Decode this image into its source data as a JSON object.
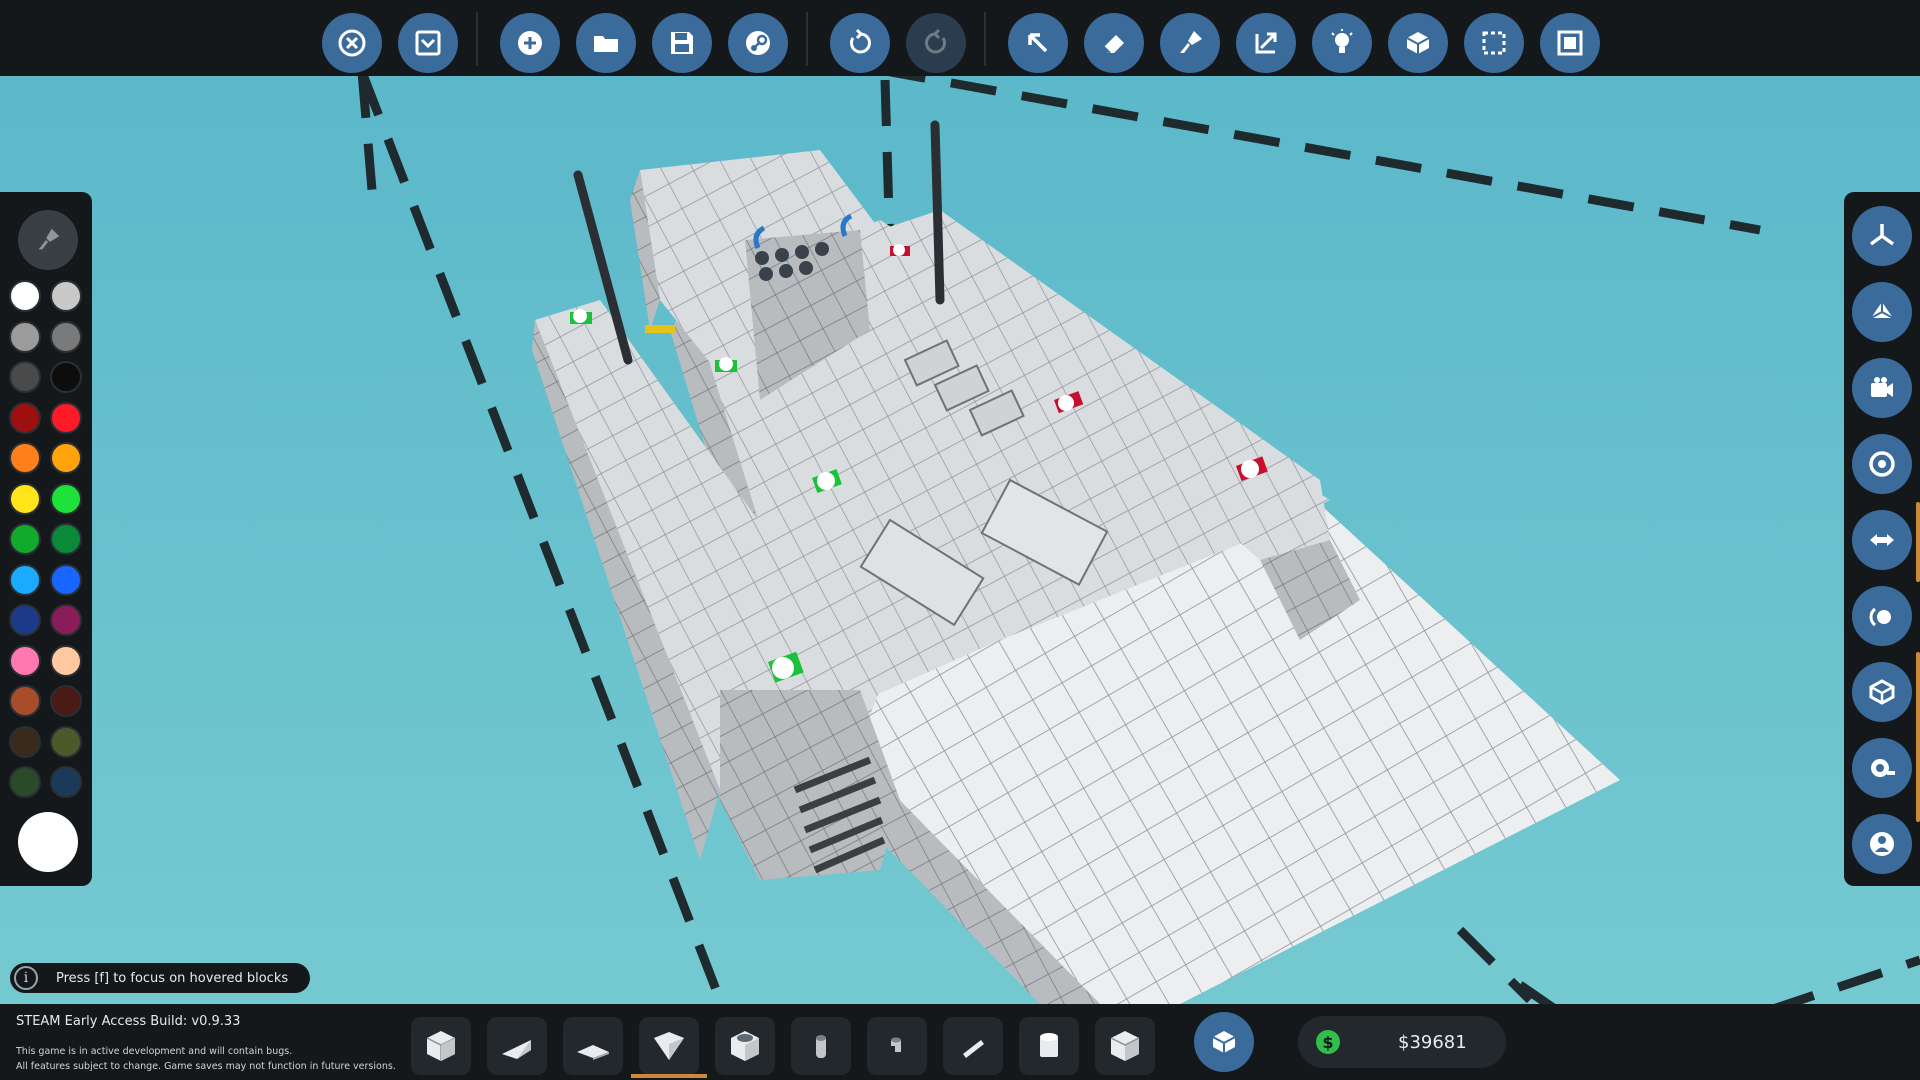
{
  "hint": {
    "text": "Press [f] to focus on hovered blocks",
    "icon": "info-icon"
  },
  "build": {
    "title": "STEAM Early Access Build: v0.9.33",
    "note1": "This game is in active development and will contain bugs.",
    "note2": "All features subject to change. Game saves may not function in future versions."
  },
  "money": {
    "value": "$39681",
    "icon": "dollar-icon",
    "color": "#2fbf4a"
  },
  "toolbar": {
    "icons": [
      "close-icon",
      "dropdown-icon",
      "add-icon",
      "folder-icon",
      "save-icon",
      "steam-icon",
      "undo-icon",
      "redo-icon",
      "select-arrow-icon",
      "eraser-icon",
      "paint-icon",
      "scale-icon",
      "light-icon",
      "blocks-icon",
      "selection-icon",
      "fullscreen-icon"
    ]
  },
  "right_panel": {
    "icons": [
      "axis-top-icon",
      "axis-side-icon",
      "camera-icon",
      "target-icon",
      "swap-icon",
      "rotate-icon",
      "block-view-icon",
      "camera-mode-icon",
      "character-icon"
    ]
  },
  "palette": {
    "selected": "#ffffff",
    "colors": [
      "#ffffff",
      "#c8c8c8",
      "#9b9b9b",
      "#7a7a7a",
      "#4a4a4a",
      "#0d0d0d",
      "#9e0f0f",
      "#ff1a28",
      "#ff7f1a",
      "#ffa30a",
      "#ffe51a",
      "#1de23a",
      "#11aa2c",
      "#0a8a38",
      "#1aaaff",
      "#1666ff",
      "#1c3a8a",
      "#8a1c5a",
      "#ff78b0",
      "#ffc8a0",
      "#a84c2a",
      "#4a1a14",
      "#3a2a1c",
      "#4a5a2a",
      "#2a4a2a",
      "#1a3a5a"
    ]
  },
  "blocks": {
    "items": [
      "cube-block-icon",
      "wedge-block-icon",
      "flat-wedge-block-icon",
      "pyramid-block-icon",
      "cylinder-block-icon",
      "pipe-block-icon",
      "pipe-bend-block-icon",
      "rod-block-icon",
      "round-block-icon",
      "corner-block-icon"
    ],
    "selected_index": 3
  }
}
